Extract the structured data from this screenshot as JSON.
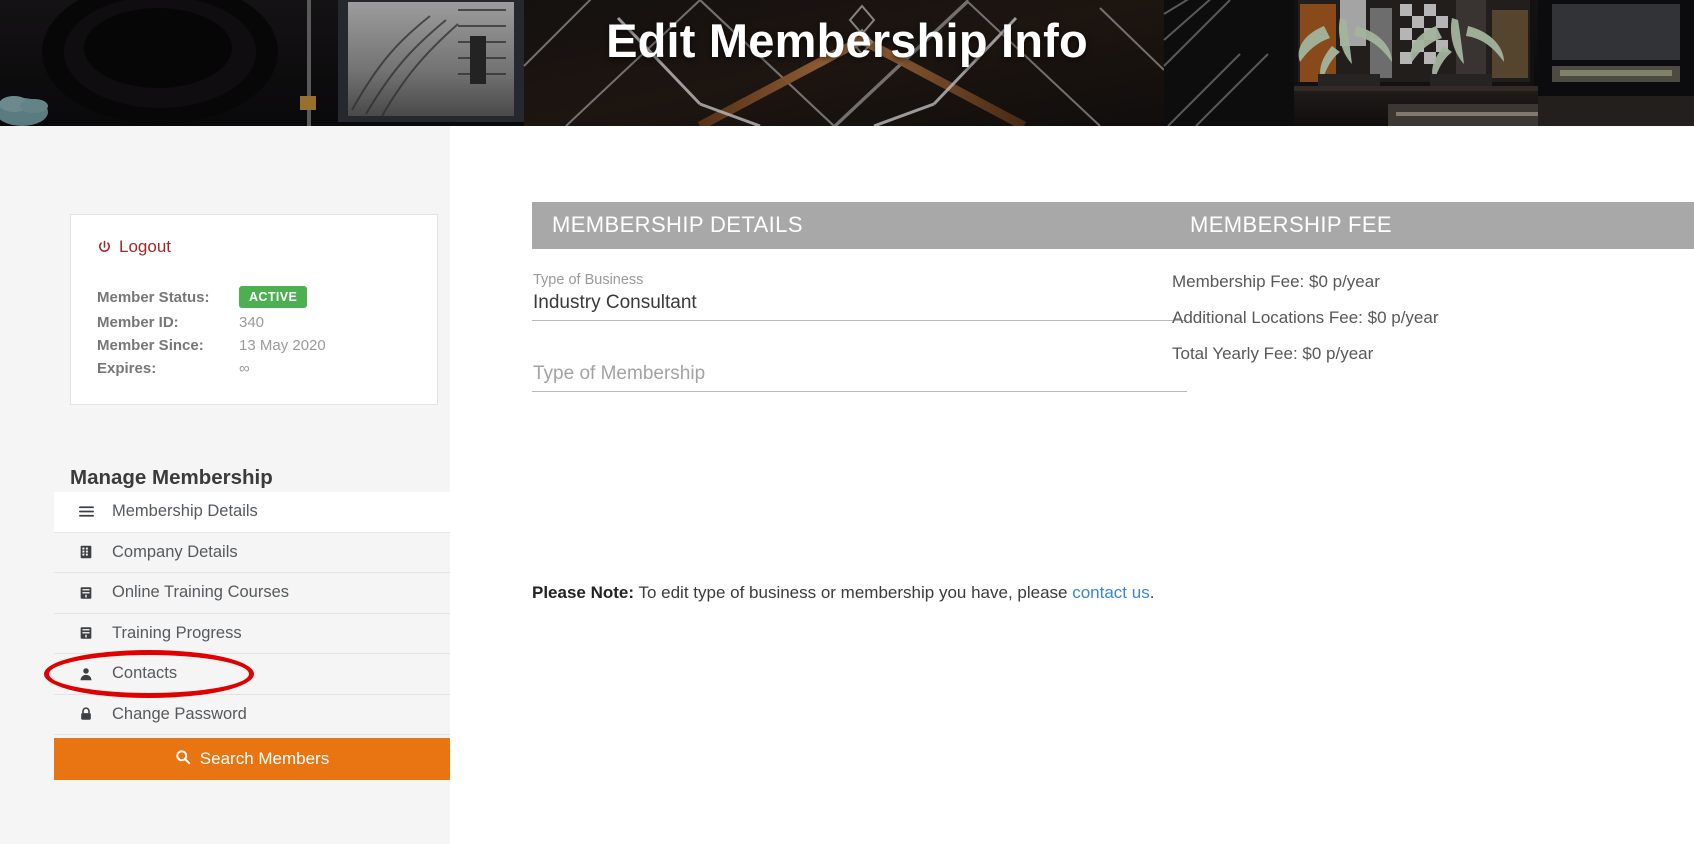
{
  "hero": {
    "title": "Edit Membership Info"
  },
  "sidebar": {
    "logout_label": "Logout",
    "logout_icon": "power-icon",
    "status": {
      "rows": [
        {
          "key": "Member Status:",
          "value": "ACTIVE",
          "is_badge": true
        },
        {
          "key": "Member ID:",
          "value": "340",
          "is_badge": false
        },
        {
          "key": "Member Since:",
          "value": "13 May 2020",
          "is_badge": false
        },
        {
          "key": "Expires:",
          "value": "∞",
          "is_badge": false
        }
      ]
    },
    "manage_title": "Manage Membership",
    "menu": [
      {
        "label": "Membership Details",
        "icon": "hamburger-menu-icon",
        "active": true
      },
      {
        "label": "Company Details",
        "icon": "building-icon",
        "active": false
      },
      {
        "label": "Online Training Courses",
        "icon": "book-icon",
        "active": false
      },
      {
        "label": "Training Progress",
        "icon": "book-icon",
        "active": false
      },
      {
        "label": "Contacts",
        "icon": "person-icon",
        "active": false
      },
      {
        "label": "Change Password",
        "icon": "lock-icon",
        "active": false
      }
    ],
    "search_button": {
      "label": "Search Members",
      "icon": "search-icon",
      "color": "#e87511"
    }
  },
  "main": {
    "details_panel": {
      "heading": "MEMBERSHIP DETAILS",
      "fields": [
        {
          "label": "Type of Business",
          "value": "Industry Consultant",
          "placeholder": ""
        },
        {
          "label": "",
          "value": "",
          "placeholder": "Type of Membership"
        }
      ]
    },
    "fee_panel": {
      "heading": "MEMBERSHIP FEE",
      "lines": [
        "Membership Fee: $0 p/year",
        "Additional Locations Fee: $0 p/year",
        "Total Yearly Fee: $0 p/year"
      ]
    },
    "note": {
      "prefix": "Please Note:",
      "body": " To edit type of business or membership you have, please ",
      "link": "contact us",
      "suffix": "."
    }
  },
  "annotation": {
    "shape": "ellipse",
    "color": "#e00000",
    "targets": "Contacts"
  },
  "colors": {
    "panel_header": "#a8a8a8",
    "accent_orange": "#e87511",
    "active_green": "#4caf50",
    "link_blue": "#3a86d6",
    "logout_red": "#a4262c",
    "sidebar_bg": "#f5f5f5"
  }
}
